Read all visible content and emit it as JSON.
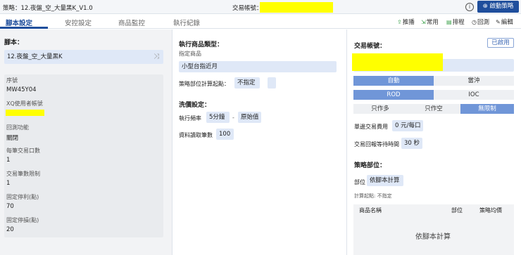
{
  "topbar": {
    "strategy": "策略：12.夜盤_空_大量黑K_V1.0",
    "account_label": "交易帳號：",
    "info_icon": "info-icon",
    "start_button": "⊕ 啟動策略"
  },
  "tabs": [
    "腳本設定",
    "安控設定",
    "商品監控",
    "執行紀錄"
  ],
  "tools": [
    {
      "icon": "push-icon",
      "label": "推播"
    },
    {
      "icon": "favorite-icon",
      "label": "常用"
    },
    {
      "icon": "schedule-icon",
      "label": "排程"
    },
    {
      "icon": "backtest-icon",
      "label": "回測"
    },
    {
      "icon": "edit-icon",
      "label": "編輯"
    }
  ],
  "left": {
    "script_label": "腳本：",
    "script_value": "12.夜盤_空_大量黑K",
    "serial_label": "序號",
    "serial_value": "MW45Y04",
    "xq_user_label": "XQ使用者帳號",
    "backtest_label": "回測功能",
    "backtest_value": "關閉",
    "lot_label": "每筆交易口數",
    "lot_value": "1",
    "limit_label": "交易筆數限制",
    "limit_value": "1",
    "take_profit_label": "固定停利(點)",
    "take_profit_value": "70",
    "stop_loss_label": "固定停損(點)",
    "stop_loss_value": "20"
  },
  "middle": {
    "product_type_label": "執行商品類型：",
    "specified_label": "指定商品",
    "specified_value": "小型台指近月",
    "position_calc_label": "策略部位計算起點：",
    "position_calc_value": "不指定",
    "wash_label": "洗價設定：",
    "freq_label": "執行頻率",
    "freq_value": "5分鐘",
    "freq_sep": "-",
    "freq_mode": "原始值",
    "bars_label": "資料讀取筆數",
    "bars_value": "100"
  },
  "right": {
    "account_label": "交易帳號：",
    "enabled_button": "已啟用",
    "mode_options": [
      "自動",
      "當沖"
    ],
    "order_options": [
      "ROD",
      "IOC"
    ],
    "direction_options": [
      "只作多",
      "只作空",
      "無限制"
    ],
    "fee_label": "單邊交易費用",
    "fee_value": "0 元/每口",
    "wait_label": "交易回報等待時間",
    "wait_value": "30 秒",
    "position_label": "策略部位：",
    "unit_label": "部位",
    "unit_value": "依腳本計算",
    "calc_start": "計算起點: 不指定",
    "table_headers": [
      "商品名稱",
      "部位",
      "策略均價"
    ],
    "table_empty": "依腳本計算"
  },
  "colors": {
    "primary": "#1f4e9c",
    "accent_on": "#7096d8",
    "highlight": "#ffff00"
  }
}
